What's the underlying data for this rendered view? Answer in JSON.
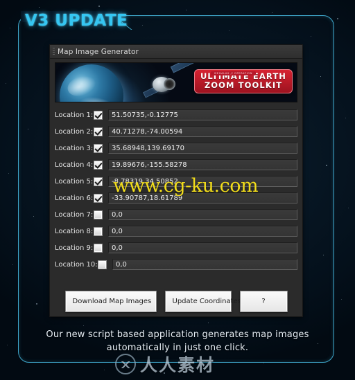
{
  "page": {
    "title": "V3 UPDATE",
    "footer_caption_line1": "Our new script based application generates map images",
    "footer_caption_line2": "automatically in just one click.",
    "accent_color": "#35c6f2",
    "frame_color": "#3fa8cc",
    "background_color": "#04101b"
  },
  "window": {
    "title": "Map Image Generator",
    "grip_icon": "drag-grip-icon"
  },
  "banner": {
    "kicker": "MEGALUX // OPERATION",
    "line1": "ULTIMATE EARTH",
    "line2": "ZOOM TOOLKIT",
    "badge_color": "#d62231",
    "earth_icon": "earth-globe-icon",
    "satellite_icon": "satellite-icon"
  },
  "locations": [
    {
      "label": "Location 1:",
      "checked": true,
      "value": "51.50735,-0.12775"
    },
    {
      "label": "Location 2:",
      "checked": true,
      "value": "40.71278,-74.00594"
    },
    {
      "label": "Location 3:",
      "checked": true,
      "value": "35.68948,139.69170"
    },
    {
      "label": "Location 4:",
      "checked": true,
      "value": "19.89676,-155.58278"
    },
    {
      "label": "Location 5:",
      "checked": true,
      "value": "-8.78319,34.50852"
    },
    {
      "label": "Location 6:",
      "checked": true,
      "value": "-33.90787,18.61789"
    },
    {
      "label": "Location 7:",
      "checked": false,
      "value": "0,0"
    },
    {
      "label": "Location 8:",
      "checked": false,
      "value": "0,0"
    },
    {
      "label": "Location 9:",
      "checked": false,
      "value": "0,0"
    },
    {
      "label": "Location 10:",
      "checked": false,
      "value": "0,0"
    }
  ],
  "buttons": {
    "download": "Download Map Images",
    "update": "Update Coordinates",
    "help": "?"
  },
  "watermarks": {
    "url": "www.cg-ku.com",
    "brand_text": "人人素材",
    "brand_logo_icon": "circle-mountain-logo-icon"
  }
}
